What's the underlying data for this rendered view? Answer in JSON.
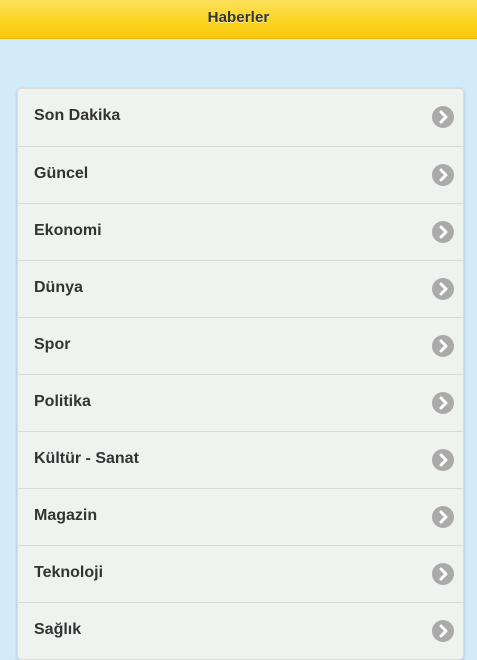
{
  "header": {
    "title": "Haberler"
  },
  "menu": {
    "items": [
      {
        "label": "Son Dakika",
        "icon": "chevron-right-icon"
      },
      {
        "label": "Güncel",
        "icon": "chevron-right-icon"
      },
      {
        "label": "Ekonomi",
        "icon": "chevron-right-icon"
      },
      {
        "label": "Dünya",
        "icon": "chevron-right-icon"
      },
      {
        "label": "Spor",
        "icon": "chevron-right-icon"
      },
      {
        "label": "Politika",
        "icon": "chevron-right-icon"
      },
      {
        "label": "Kültür - Sanat",
        "icon": "chevron-right-icon"
      },
      {
        "label": "Magazin",
        "icon": "chevron-right-icon"
      },
      {
        "label": "Teknoloji",
        "icon": "chevron-right-icon"
      },
      {
        "label": "Sağlık",
        "icon": "chevron-right-icon"
      }
    ]
  },
  "colors": {
    "header": "#fbd421",
    "background": "#d2ebf8",
    "list": "#eff3f0",
    "chevron": "#a9aaa9",
    "text": "#333333"
  }
}
